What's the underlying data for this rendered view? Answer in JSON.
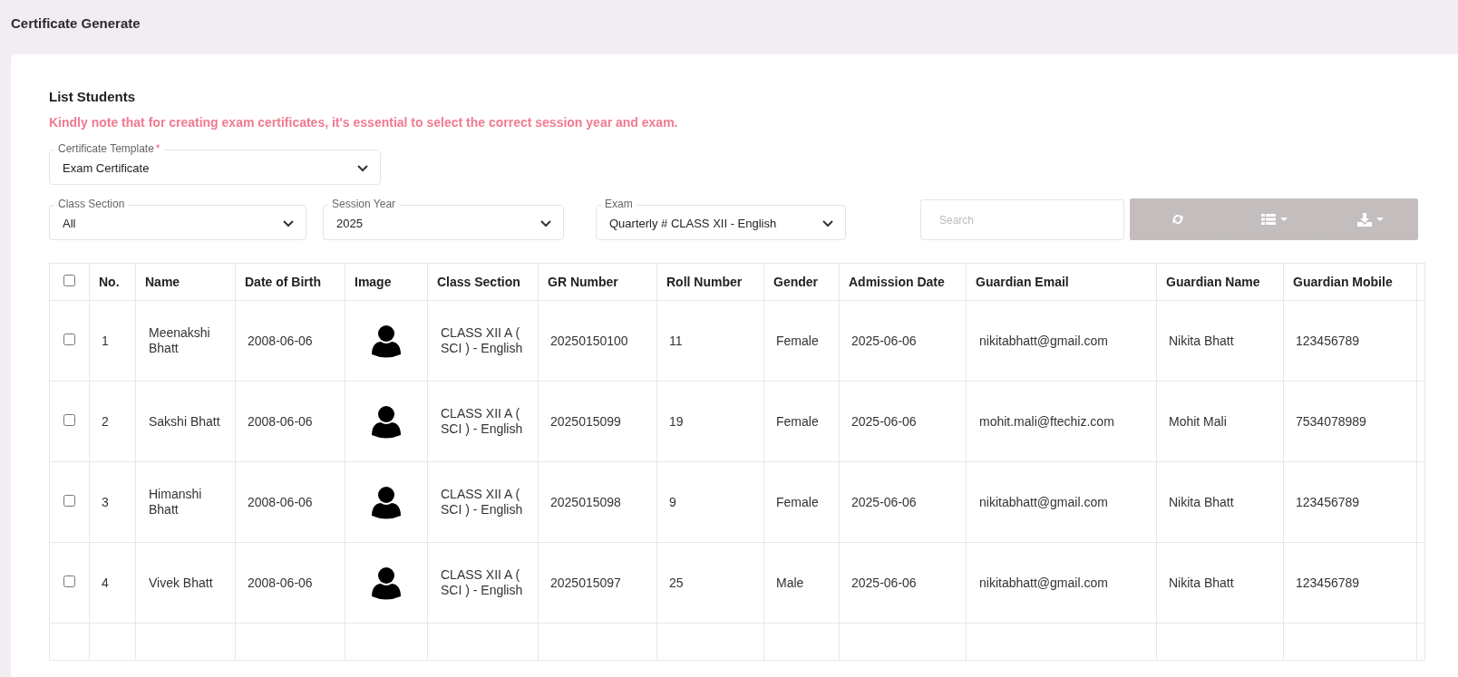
{
  "page_title": "Certificate Generate",
  "card": {
    "title": "List Students",
    "notice": "Kindly note that for creating exam certificates, it's essential to select the correct session year and exam."
  },
  "template_field": {
    "label": "Certificate Template",
    "required_mark": "*",
    "value": "Exam Certificate"
  },
  "filters": [
    {
      "label": "Class Section",
      "value": "All"
    },
    {
      "label": "Session Year",
      "value": "2025"
    },
    {
      "label": "Exam",
      "value": "Quarterly # CLASS XII - English"
    }
  ],
  "search": {
    "placeholder": "Search"
  },
  "toolbar": [
    {
      "kind": "refresh"
    },
    {
      "kind": "columns"
    },
    {
      "kind": "export"
    }
  ],
  "table": {
    "select_all_checked": false,
    "columns": [
      "No.",
      "Name",
      "Date of Birth",
      "Image",
      "Class Section",
      "GR Number",
      "Roll Number",
      "Gender",
      "Admission Date",
      "Guardian Email",
      "Guardian Name",
      "Guardian Mobile"
    ],
    "rows": [
      {
        "checked": false,
        "cells": [
          "1",
          "Meenakshi Bhatt",
          "2008-06-06",
          "",
          "CLASS XII A ( SCI ) - English",
          "20250150100",
          "11",
          "Female",
          "2025-06-06",
          "nikitabhatt@gmail.com",
          "Nikita Bhatt",
          "123456789"
        ]
      },
      {
        "checked": false,
        "cells": [
          "2",
          "Sakshi Bhatt",
          "2008-06-06",
          "",
          "CLASS XII A ( SCI ) - English",
          "2025015099",
          "19",
          "Female",
          "2025-06-06",
          "mohit.mali@ftechiz.com",
          "Mohit Mali",
          "7534078989"
        ]
      },
      {
        "checked": false,
        "cells": [
          "3",
          "Himanshi Bhatt",
          "2008-06-06",
          "",
          "CLASS XII A ( SCI ) - English",
          "2025015098",
          "9",
          "Female",
          "2025-06-06",
          "nikitabhatt@gmail.com",
          "Nikita Bhatt",
          "123456789"
        ]
      },
      {
        "checked": false,
        "cells": [
          "4",
          "Vivek Bhatt",
          "2008-06-06",
          "",
          "CLASS XII A ( SCI ) - English",
          "2025015097",
          "25",
          "Male",
          "2025-06-06",
          "nikitabhatt@gmail.com",
          "Nikita Bhatt",
          "123456789"
        ]
      }
    ]
  }
}
